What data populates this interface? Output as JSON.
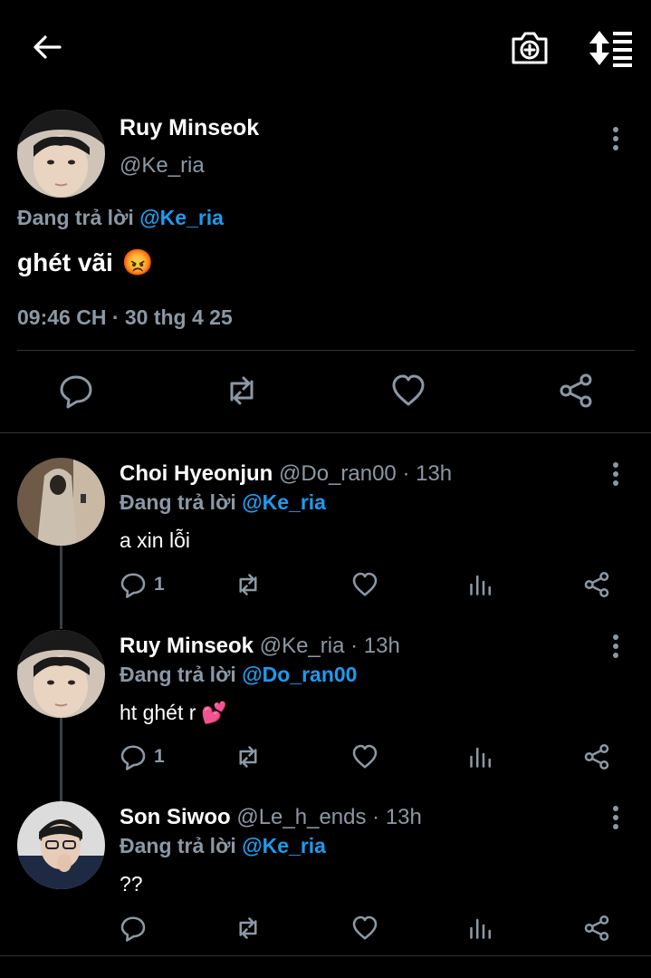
{
  "header": {
    "back_icon": "arrow-left-icon",
    "camera_icon": "camera-add-icon",
    "sort_icon": "sort-thread-icon"
  },
  "main_tweet": {
    "name": "Ruy Minseok",
    "handle": "@Ke_ria",
    "replying_prefix": "Đang trả lời",
    "replying_to": "@Ke_ria",
    "text": "ghét vãi",
    "emoji": "😡",
    "timestamp": "09:46 CH · 30 thg 4 25"
  },
  "replies": [
    {
      "name": "Choi Hyeonjun",
      "handle": "@Do_ran00",
      "time": "· 13h",
      "replying_prefix": "Đang trả lời",
      "replying_to": "@Ke_ria",
      "text": "a xin lỗi",
      "emoji": "",
      "reply_count": "1"
    },
    {
      "name": "Ruy Minseok",
      "handle": "@Ke_ria",
      "time": "· 13h",
      "replying_prefix": "Đang trả lời",
      "replying_to": "@Do_ran00",
      "text": "ht ghét r",
      "emoji": "💕",
      "reply_count": "1"
    },
    {
      "name": "Son Siwoo",
      "handle": "@Le_h_ends",
      "time": "· 13h",
      "replying_prefix": "Đang trả lời",
      "replying_to": "@Ke_ria",
      "text": "??",
      "emoji": "",
      "reply_count": ""
    }
  ],
  "colors": {
    "background": "#000000",
    "accent": "#1d9bf0",
    "muted": "#8b98a5"
  }
}
